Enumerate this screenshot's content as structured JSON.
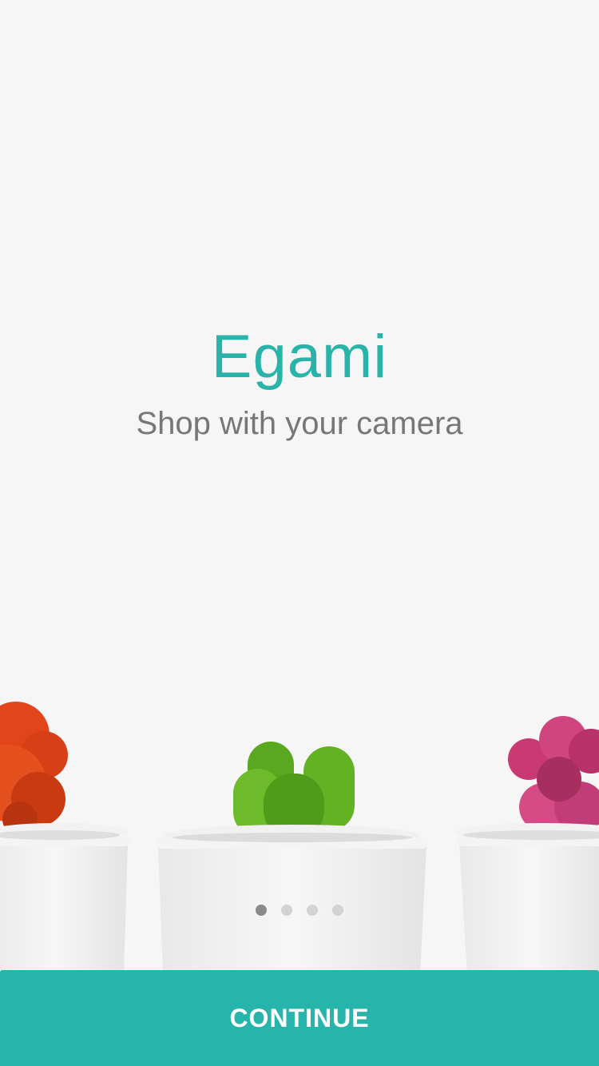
{
  "app": {
    "title": "Egami",
    "tagline": "Shop with your camera"
  },
  "onboarding": {
    "page_count": 4,
    "current_page": 1
  },
  "footer": {
    "continue_label": "CONTINUE"
  },
  "colors": {
    "accent": "#27b4aa",
    "title": "#2ab3a8",
    "tagline": "#777777",
    "background": "#f6f6f6"
  },
  "illustration": {
    "icons": [
      "orange-cactus-icon",
      "green-cactus-icon",
      "pink-cactus-icon"
    ]
  }
}
